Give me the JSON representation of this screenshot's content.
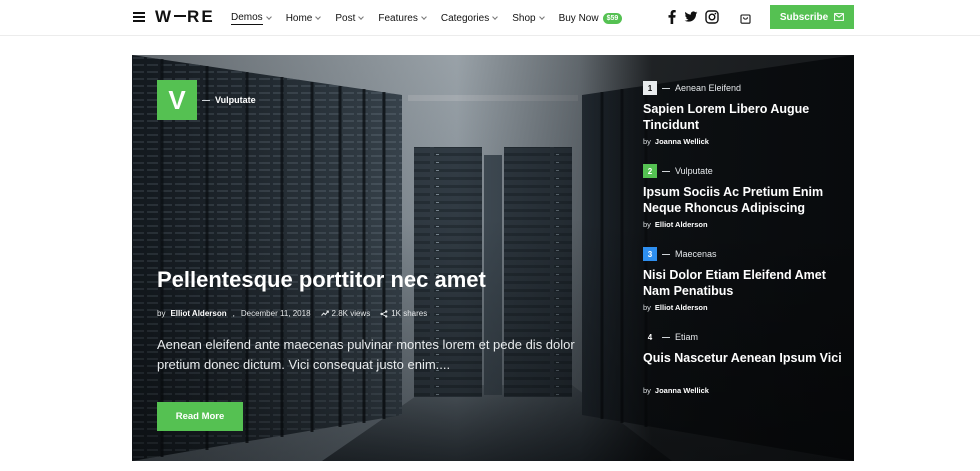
{
  "brand": {
    "logo_left": "W",
    "logo_right": "RE"
  },
  "nav": {
    "items": [
      {
        "label": "Demos"
      },
      {
        "label": "Home"
      },
      {
        "label": "Post"
      },
      {
        "label": "Features"
      },
      {
        "label": "Categories"
      },
      {
        "label": "Shop"
      },
      {
        "label": "Buy Now",
        "badge": "$59"
      }
    ]
  },
  "header": {
    "subscribe_label": "Subscribe"
  },
  "icons": {
    "menu": "hamburger-menu-icon",
    "facebook": "facebook-icon",
    "twitter": "twitter-icon",
    "instagram": "instagram-icon",
    "cart": "shopping-bag-icon",
    "mail": "mail-icon"
  },
  "hero": {
    "category_letter": "V",
    "category": "Vulputate",
    "title": "Pellentesque porttitor nec amet",
    "by": "by",
    "author": "Elliot Alderson",
    "date": "December 11, 2018",
    "views": "2.8K views",
    "shares": "1K shares",
    "excerpt": "Aenean eleifend ante maecenas pulvinar montes lorem et pede dis dolor pretium donec dictum. Vici consequat justo enim....",
    "cta": "Read More"
  },
  "side_list": [
    {
      "num": "1",
      "category": "Aenean Eleifend",
      "title": "Sapien Lorem Libero Augue Tincidunt",
      "by": "by",
      "author": "Joanna Wellick"
    },
    {
      "num": "2",
      "category": "Vulputate",
      "title": "Ipsum Sociis Ac Pretium Enim Neque Rhoncus Adipiscing",
      "by": "by",
      "author": "Elliot Alderson"
    },
    {
      "num": "3",
      "category": "Maecenas",
      "title": "Nisi Dolor Etiam Eleifend Amet Nam Penatibus",
      "by": "by",
      "author": "Elliot Alderson"
    },
    {
      "num": "4",
      "category": "Etiam",
      "title": "Quis Nascetur Aenean Ipsum Vici",
      "by": "by",
      "author": "Joanna Wellick"
    }
  ],
  "colors": {
    "accent": "#55c152",
    "blue_badge": "#2e8ff0",
    "dark_panel": "#0e1114"
  }
}
